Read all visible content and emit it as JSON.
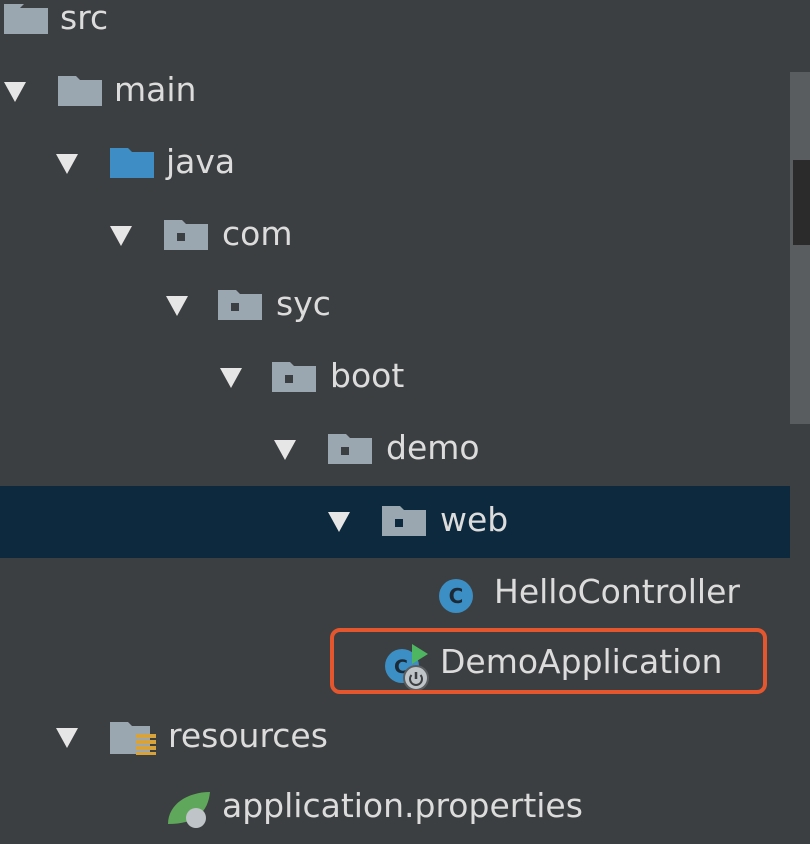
{
  "tree": {
    "items": [
      {
        "label": "src",
        "icon": "folder-icon"
      },
      {
        "label": "main",
        "icon": "folder-icon"
      },
      {
        "label": "java",
        "icon": "source-folder-icon"
      },
      {
        "label": "com",
        "icon": "package-icon"
      },
      {
        "label": "syc",
        "icon": "package-icon"
      },
      {
        "label": "boot",
        "icon": "package-icon"
      },
      {
        "label": "demo",
        "icon": "package-icon"
      },
      {
        "label": "web",
        "icon": "package-icon",
        "selected": true
      },
      {
        "label": "HelloController",
        "icon": "class-icon"
      },
      {
        "label": "DemoApplication",
        "icon": "spring-boot-application-icon",
        "highlighted": true
      },
      {
        "label": "resources",
        "icon": "resources-folder-icon"
      },
      {
        "label": "application.properties",
        "icon": "spring-properties-icon"
      }
    ]
  },
  "colors": {
    "background": "#3c3f41",
    "selection": "#0d293e",
    "highlight_border": "#e4572e",
    "source_folder": "#3e8ec5",
    "class_icon": "#3c8fc4"
  }
}
